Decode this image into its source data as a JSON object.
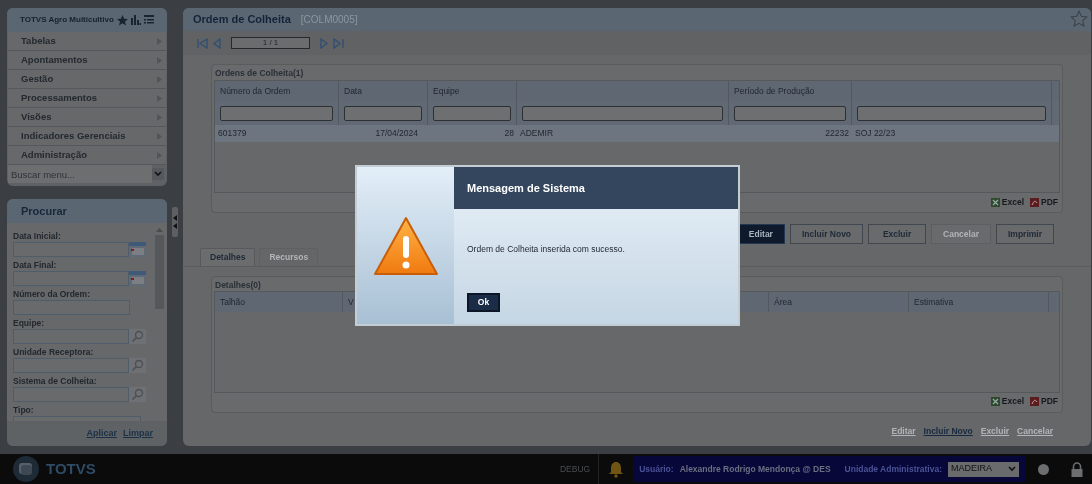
{
  "app": {
    "title": "TOTVS Agro Multicultivo"
  },
  "menu": [
    {
      "label": "Tabelas"
    },
    {
      "label": "Apontamentos"
    },
    {
      "label": "Gestão"
    },
    {
      "label": "Processamentos"
    },
    {
      "label": "Visões"
    },
    {
      "label": "Indicadores Gerenciais"
    },
    {
      "label": "Administração"
    }
  ],
  "menu_search": {
    "placeholder": "Buscar menu..."
  },
  "search_panel": {
    "title": "Procurar",
    "fields": [
      {
        "label": "Data Inicial:",
        "kind": "date"
      },
      {
        "label": "Data Final:",
        "kind": "date"
      },
      {
        "label": "Número da Ordem:",
        "kind": "text"
      },
      {
        "label": "Equipe:",
        "kind": "lookup"
      },
      {
        "label": "Unidade Receptora:",
        "kind": "lookup"
      },
      {
        "label": "Sistema de Colheita:",
        "kind": "lookup"
      },
      {
        "label": "Tipo:",
        "kind": "select"
      }
    ],
    "links": [
      "Aplicar",
      "Limpar"
    ]
  },
  "page": {
    "title": "Ordem de Colheita",
    "code": "[COLM0005]",
    "pager": "1 / 1"
  },
  "orders": {
    "title": "Ordens de Colheita(1)",
    "columns": [
      {
        "label": "Número da Ordem"
      },
      {
        "label": "Data"
      },
      {
        "label": "Equipe"
      },
      {},
      {
        "label": "Período de Produção"
      },
      {}
    ],
    "rows": [
      {
        "cells": [
          "601379",
          "17/04/2024",
          "28",
          "ADEMIR",
          "22232",
          "SOJ 22/23"
        ],
        "selected": true
      }
    ],
    "export": [
      "Excel",
      "PDF"
    ]
  },
  "actions": [
    {
      "label": "Editar",
      "kind": "primary",
      "disabled": false
    },
    {
      "label": "Incluir Novo",
      "kind": "normal",
      "disabled": false
    },
    {
      "label": "Excluir",
      "kind": "normal",
      "disabled": false
    },
    {
      "label": "Cancelar",
      "kind": "normal",
      "disabled": true
    },
    {
      "label": "Imprimir",
      "kind": "normal",
      "disabled": false
    }
  ],
  "tabs": [
    {
      "label": "Detalhes",
      "selected": true
    },
    {
      "label": "Recursos",
      "selected": false
    }
  ],
  "details": {
    "title": "Detalhes(0)",
    "columns": [
      {
        "label": "Talhão"
      },
      {
        "label": "V"
      },
      {
        "label": "Área"
      },
      {
        "label": "Estimativa"
      }
    ],
    "export": [
      "Excel",
      "PDF"
    ],
    "links": [
      {
        "label": "Editar",
        "disabled": true
      },
      {
        "label": "Incluir Novo",
        "disabled": false
      },
      {
        "label": "Excluir",
        "disabled": true
      },
      {
        "label": "Cancelar",
        "disabled": true
      }
    ]
  },
  "status_bar": {
    "brand": "TOTVS",
    "debug": "DEBUG",
    "user_label": "Usuário:",
    "user": "Alexandre Rodrigo Mendonça @ DES",
    "unit_label": "Unidade Administrativa:",
    "unit": "MADEIRA"
  },
  "dialog": {
    "title": "Mensagem de Sistema",
    "message": "Ordem de Colheita inserida com sucesso.",
    "button": "Ok"
  }
}
